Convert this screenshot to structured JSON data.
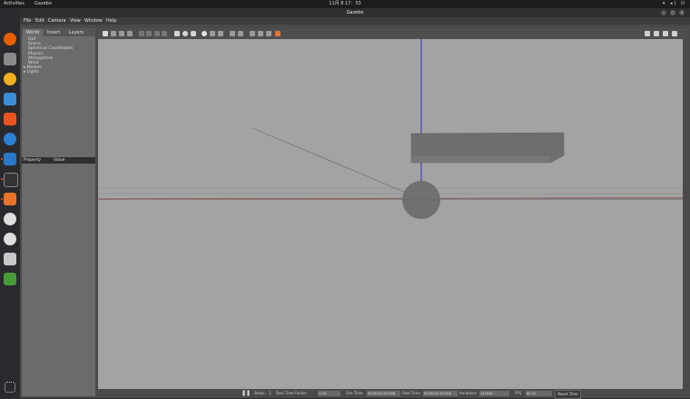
{
  "topbar": {
    "activities": "Activities",
    "app": "Gazebo",
    "clock": "11月 8 17：53",
    "tray": "▾ ◂) ⏻"
  },
  "window": {
    "title": "Gazebo",
    "btn_min": "–",
    "btn_max": "▢",
    "btn_close": "×"
  },
  "menu": {
    "file": "File",
    "edit": "Edit",
    "camera": "Camera",
    "view": "View",
    "window": "Window",
    "help": "Help"
  },
  "tabs": {
    "world": "World",
    "insert": "Insert",
    "layers": "Layers"
  },
  "tree": {
    "gui": "GUI",
    "scene": "Scene",
    "spherical": "Spherical Coordinates",
    "physics": "Physics",
    "atmosphere": "Atmosphere",
    "wind": "Wind",
    "models": "Models",
    "lights": "Lights"
  },
  "props": {
    "property": "Property",
    "value": "Value"
  },
  "status": {
    "steps_label": "Steps:",
    "steps_value": "1",
    "rtf_label": "Real Time Factor:",
    "rtf_value": "1.00",
    "sim_label": "Sim Time",
    "sim_value": "00:00:01:53.038",
    "real_label": "Real Time",
    "real_value": "00:00:01:53.316",
    "iter_label": "Iterations",
    "iter_value": "113024",
    "fps_label": "FPS",
    "fps_value": "62.51",
    "reset": "Reset Time"
  }
}
